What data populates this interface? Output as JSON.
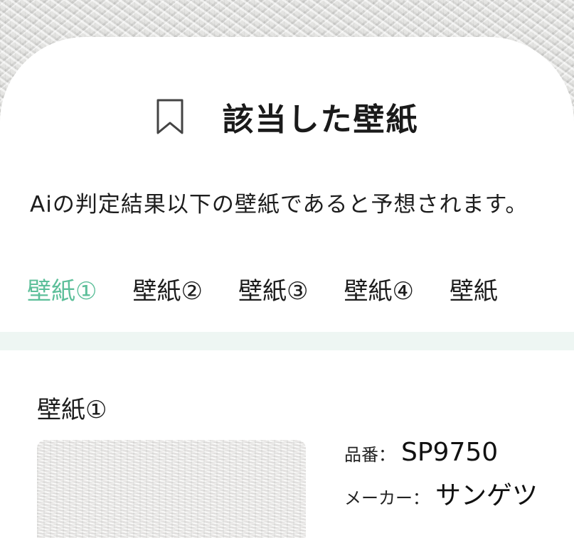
{
  "header": {
    "icon": "bookmark-icon",
    "title": "該当した壁紙"
  },
  "description": "Aiの判定結果以下の壁紙であると予想されます。",
  "tabs": [
    {
      "label": "壁紙①",
      "active": true
    },
    {
      "label": "壁紙②",
      "active": false
    },
    {
      "label": "壁紙③",
      "active": false
    },
    {
      "label": "壁紙④",
      "active": false
    },
    {
      "label": "壁紙",
      "active": false
    }
  ],
  "result": {
    "section_title": "壁紙①",
    "product_number_label": "品番：",
    "product_number": "SP9750",
    "maker_label": "メーカー：",
    "maker": "サンゲツ"
  },
  "colors": {
    "accent": "#5dbf9a",
    "band": "#eef6f3"
  }
}
